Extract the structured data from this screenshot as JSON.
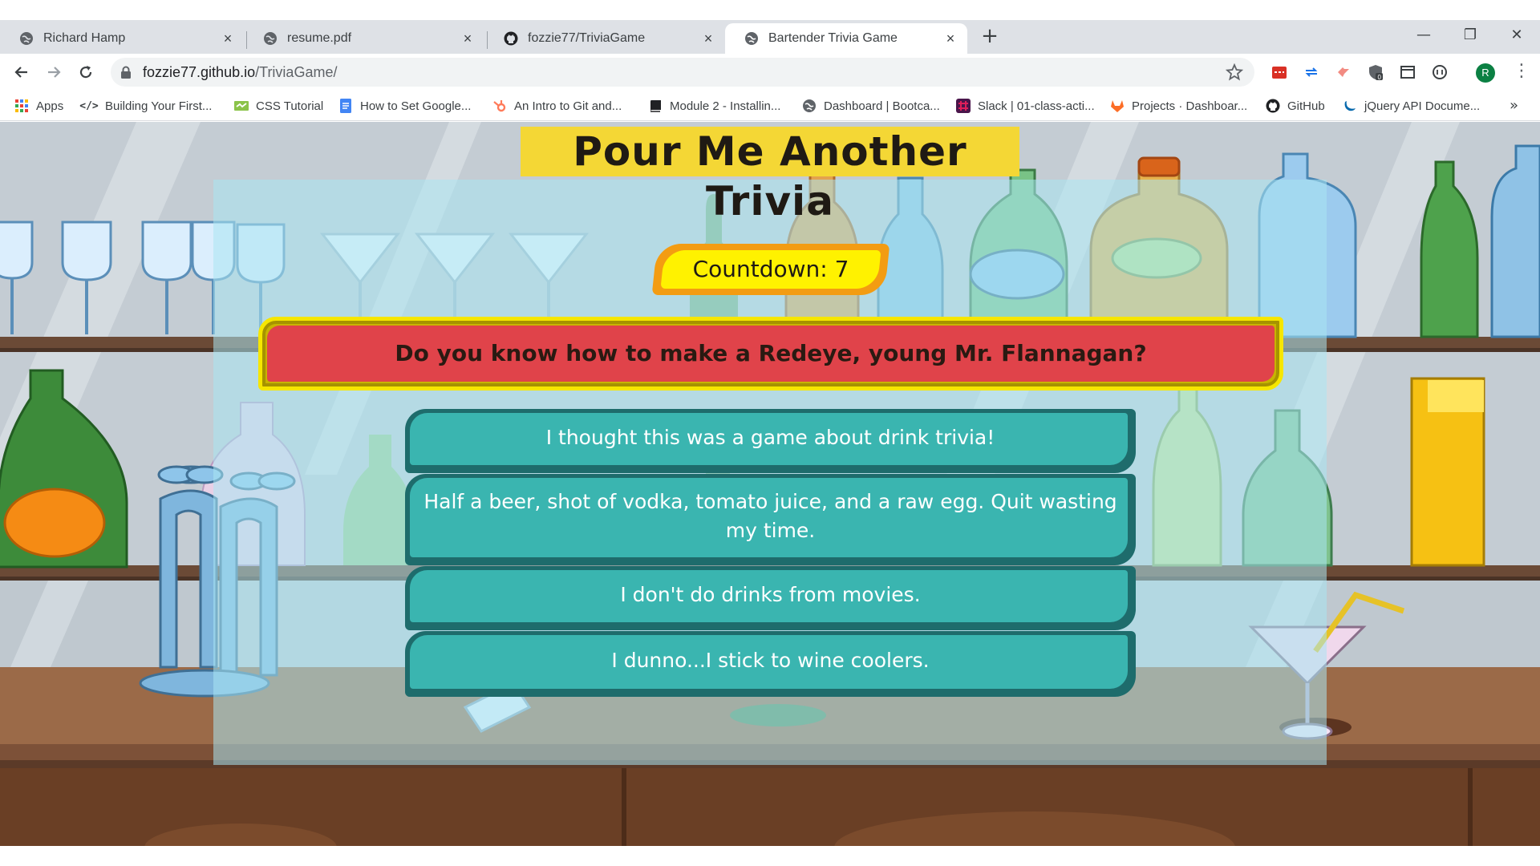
{
  "browser": {
    "tabs": [
      {
        "title": "Richard Hamp",
        "icon": "globe-icon"
      },
      {
        "title": "resume.pdf",
        "icon": "globe-icon"
      },
      {
        "title": "fozzie77/TriviaGame",
        "icon": "github-icon"
      },
      {
        "title": "Bartender Trivia Game",
        "icon": "globe-icon",
        "active": true
      }
    ],
    "url_host": "fozzie77.github.io",
    "url_path": "/TriviaGame/",
    "avatar_letter": "R",
    "bookmarks": [
      {
        "label": "Apps",
        "icon": "apps-grid-icon"
      },
      {
        "label": "Building Your First...",
        "icon": "code-icon"
      },
      {
        "label": "CSS Tutorial",
        "icon": "css-icon"
      },
      {
        "label": "How to Set Google...",
        "icon": "docs-icon"
      },
      {
        "label": "An Intro to Git and...",
        "icon": "hubspot-icon"
      },
      {
        "label": "Module 2 - Installin...",
        "icon": "book-icon"
      },
      {
        "label": "Dashboard | Bootca...",
        "icon": "globe-icon"
      },
      {
        "label": "Slack | 01-class-acti...",
        "icon": "slack-icon"
      },
      {
        "label": "Projects · Dashboar...",
        "icon": "gitlab-icon"
      },
      {
        "label": "GitHub",
        "icon": "github-icon"
      },
      {
        "label": "jQuery API Docume...",
        "icon": "jquery-icon"
      }
    ]
  },
  "game": {
    "title": "Pour Me Another Trivia",
    "countdown_label": "Countdown: 7",
    "question": "Do you know how to make a Redeye, young Mr. Flannagan?",
    "answers": [
      "I thought this was a game about drink trivia!",
      "Half a beer, shot of vodka, tomato juice, and a raw egg. Quit wasting my time.",
      "I don't do drinks from movies.",
      "I dunno...I stick to wine coolers."
    ]
  },
  "colors": {
    "title_bg": "#f4d735",
    "countdown_bg": "#fff200",
    "question_bg": "#e0434a",
    "answer_bg": "#3ab5b0"
  }
}
